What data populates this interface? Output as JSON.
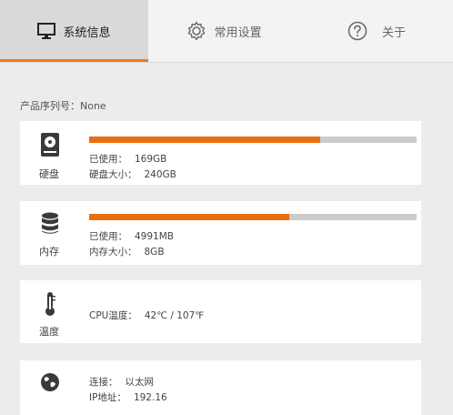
{
  "tabs": [
    {
      "label": "系统信息",
      "icon": "monitor-icon",
      "active": true
    },
    {
      "label": "常用设置",
      "icon": "gear-icon",
      "active": false
    },
    {
      "label": "关于",
      "icon": "question-icon",
      "active": false
    }
  ],
  "serial": {
    "label": "产品序列号：",
    "value": "None"
  },
  "disk": {
    "label": "硬盘",
    "icon": "hard-disk-icon",
    "used_fraction": 0.705,
    "used_label": "已使用：",
    "used_value": "169GB",
    "size_label": "硬盘大小：",
    "size_value": "240GB"
  },
  "memory": {
    "label": "内存",
    "icon": "database-icon",
    "used_fraction": 0.61,
    "used_label": "已使用：",
    "used_value": "4991MB",
    "size_label": "内存大小：",
    "size_value": "8GB"
  },
  "temperature": {
    "label": "温度",
    "icon": "thermometer-icon",
    "cpu_label": "CPU温度：",
    "cpu_value": "42℃ / 107℉"
  },
  "network": {
    "icon": "globe-icon",
    "conn_label": "连接：",
    "conn_value": "以太网",
    "ip_label": "IP地址：",
    "ip_value": "192.16"
  },
  "colors": {
    "accent": "#e96f13",
    "track": "#cccccc"
  }
}
